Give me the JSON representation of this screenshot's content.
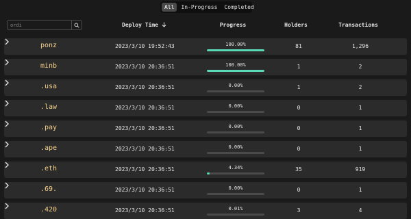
{
  "filter_tabs": [
    "All",
    "In-Progress",
    "Completed"
  ],
  "active_tab": 0,
  "search": {
    "placeholder": "ordi"
  },
  "columns": {
    "deploy_time": "Deploy Time",
    "progress": "Progress",
    "holders": "Holders",
    "transactions": "Transactions"
  },
  "rows": [
    {
      "tick": "ponz",
      "deploy_time": "2023/3/10 19:52:43",
      "progress": "100.00%",
      "progress_value": 100,
      "holders": "81",
      "transactions": "1,296"
    },
    {
      "tick": "minb",
      "deploy_time": "2023/3/10 20:36:51",
      "progress": "100.00%",
      "progress_value": 100,
      "holders": "1",
      "transactions": "2"
    },
    {
      "tick": ".usa",
      "deploy_time": "2023/3/10 20:36:51",
      "progress": "0.00%",
      "progress_value": 0,
      "holders": "1",
      "transactions": "2"
    },
    {
      "tick": ".law",
      "deploy_time": "2023/3/10 20:36:51",
      "progress": "0.00%",
      "progress_value": 0,
      "holders": "0",
      "transactions": "1"
    },
    {
      "tick": ".pay",
      "deploy_time": "2023/3/10 20:36:51",
      "progress": "0.00%",
      "progress_value": 0,
      "holders": "0",
      "transactions": "1"
    },
    {
      "tick": ".ape",
      "deploy_time": "2023/3/10 20:36:51",
      "progress": "0.00%",
      "progress_value": 0,
      "holders": "0",
      "transactions": "1"
    },
    {
      "tick": ".eth",
      "deploy_time": "2023/3/10 20:36:51",
      "progress": "4.34%",
      "progress_value": 4.34,
      "holders": "35",
      "transactions": "919"
    },
    {
      "tick": ".69.",
      "deploy_time": "2023/3/10 20:36:51",
      "progress": "0.00%",
      "progress_value": 0,
      "holders": "0",
      "transactions": "1"
    },
    {
      "tick": ".420",
      "deploy_time": "2023/3/10 20:36:51",
      "progress": "0.01%",
      "progress_value": 0.01,
      "holders": "3",
      "transactions": "4"
    }
  ],
  "colors": {
    "accent": "#59d9b5",
    "tick": "#f5d08a",
    "row_bg": "#2b2b2b",
    "page_bg": "#1a1a1a"
  }
}
